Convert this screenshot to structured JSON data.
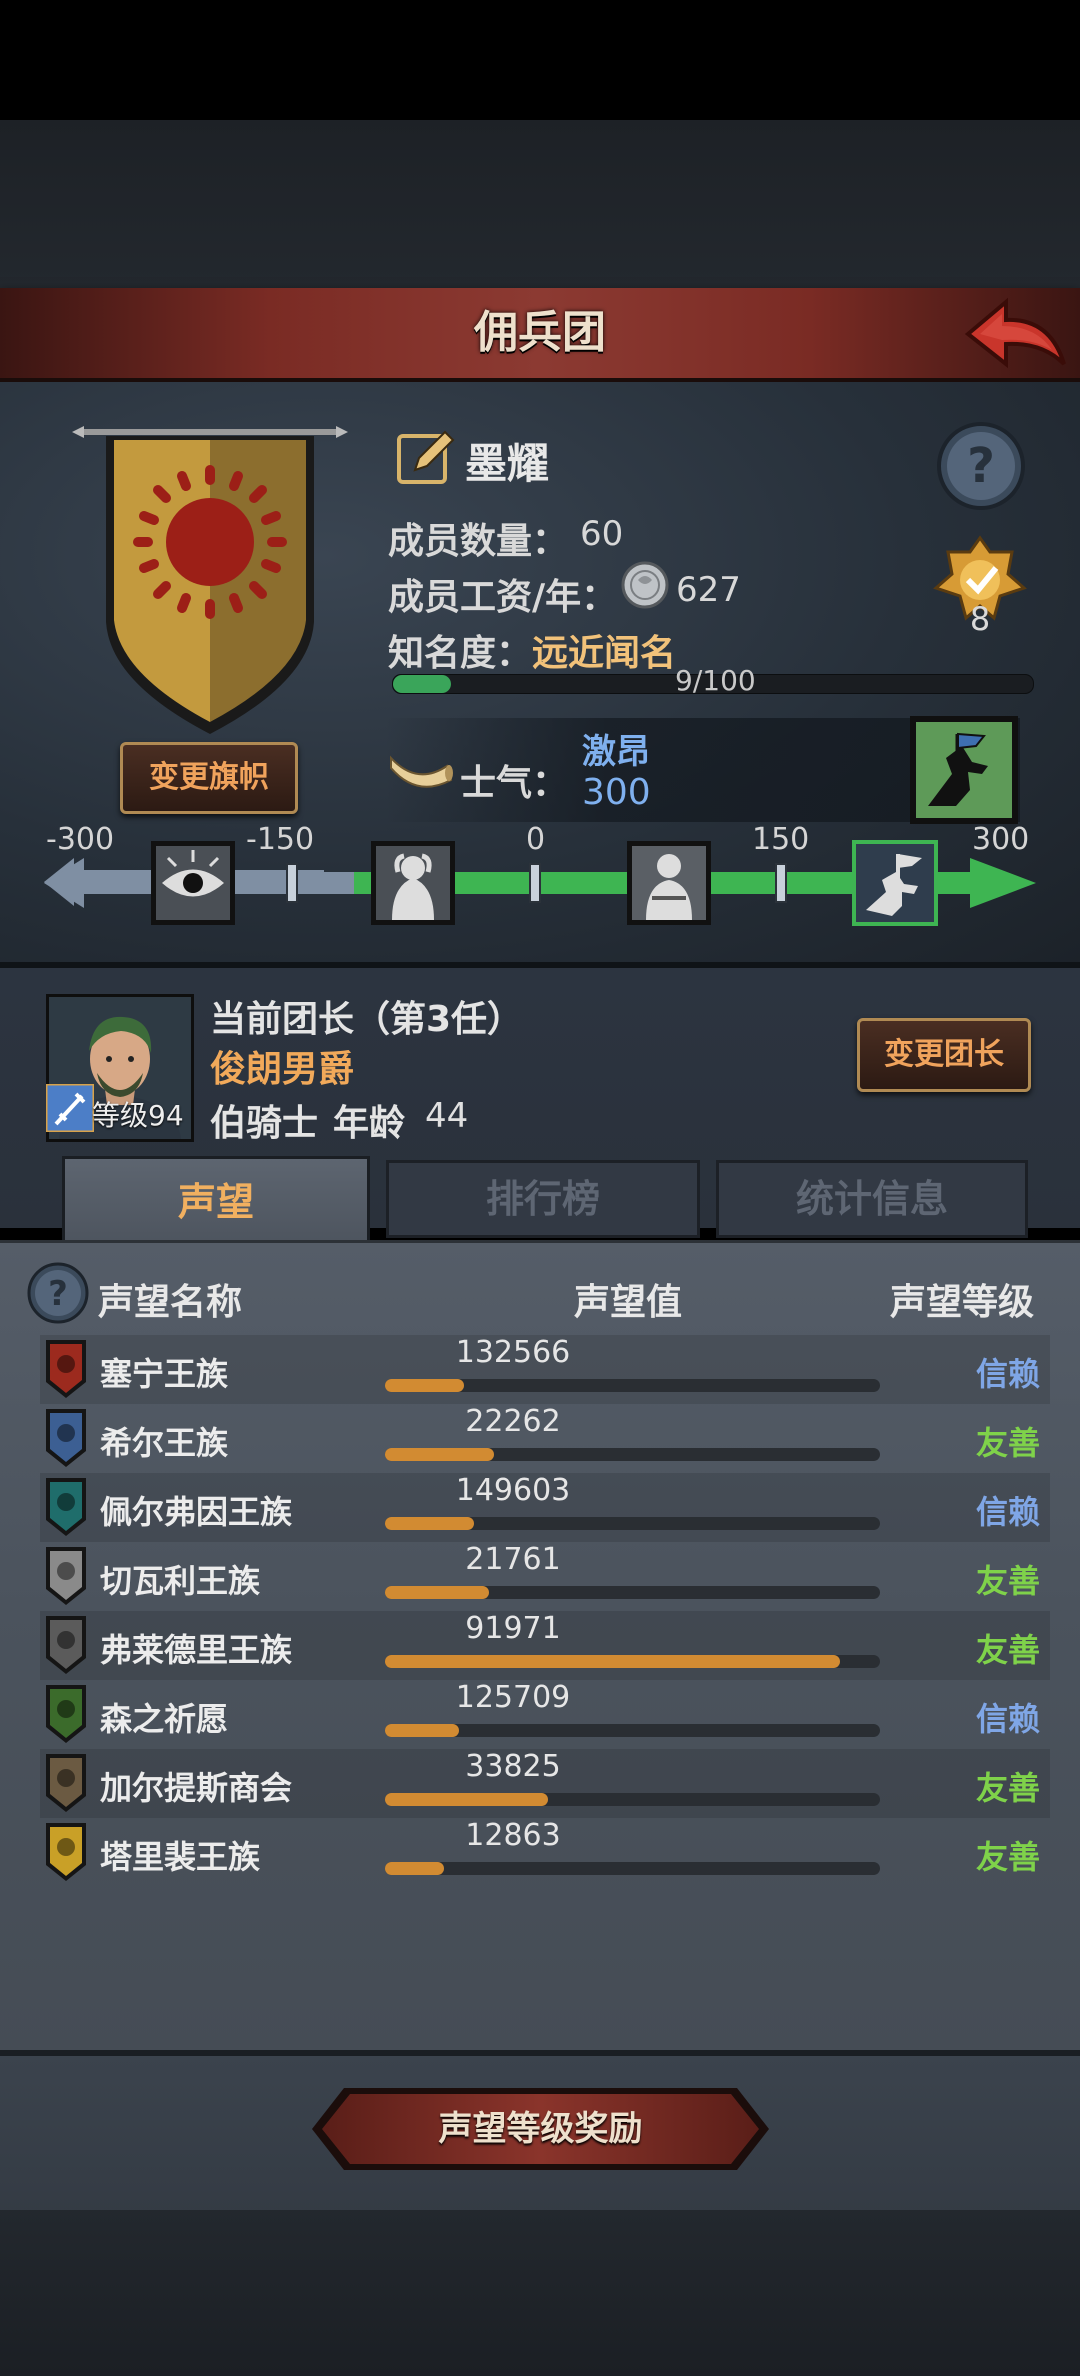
{
  "header": {
    "title": "佣兵团"
  },
  "guild": {
    "name": "墨耀",
    "change_flag_label": "变更旗帜",
    "members_label": "成员数量：",
    "members_value": "60",
    "salary_label": "成员工资/年：",
    "salary_value": "627",
    "fame_label": "知名度：",
    "fame_value": "远近闻名",
    "fame_progress": "9/100",
    "fame_fraction": 0.09,
    "rank_value": "8"
  },
  "morale": {
    "label": "士气：",
    "state": "激昂",
    "value": "300",
    "scale_labels": [
      "-300",
      "-150",
      "0",
      "150",
      "300"
    ]
  },
  "captain": {
    "title": "当前团长（第3任）",
    "name": "俊朗男爵",
    "rank": "伯骑士",
    "age_label": "年龄",
    "age": "44",
    "level": "等级94",
    "change_label": "变更团长"
  },
  "tabs": {
    "reputation": "声望",
    "ranking": "排行榜",
    "stats": "统计信息"
  },
  "reputation": {
    "headers": {
      "name": "声望名称",
      "value": "声望值",
      "level": "声望等级"
    },
    "rows": [
      {
        "name": "塞宁王族",
        "value": "132566",
        "level": "信赖",
        "fill": 0.16,
        "level_color": "#7fa6e6",
        "icon_color": "#9c2a1e"
      },
      {
        "name": "希尔王族",
        "value": "22262",
        "level": "友善",
        "fill": 0.22,
        "level_color": "#7fd24a",
        "icon_color": "#3c5f93"
      },
      {
        "name": "佩尔弗因王族",
        "value": "149603",
        "level": "信赖",
        "fill": 0.18,
        "level_color": "#7fa6e6",
        "icon_color": "#1f6d6b"
      },
      {
        "name": "切瓦利王族",
        "value": "21761",
        "level": "友善",
        "fill": 0.21,
        "level_color": "#7fd24a",
        "icon_color": "#8a8a8a"
      },
      {
        "name": "弗莱德里王族",
        "value": "91971",
        "level": "友善",
        "fill": 0.92,
        "level_color": "#7fd24a",
        "icon_color": "#5b5b5b"
      },
      {
        "name": "森之祈愿",
        "value": "125709",
        "level": "信赖",
        "fill": 0.15,
        "level_color": "#7fa6e6",
        "icon_color": "#3b6b2b"
      },
      {
        "name": "加尔提斯商会",
        "value": "33825",
        "level": "友善",
        "fill": 0.33,
        "level_color": "#7fd24a",
        "icon_color": "#6b5a42"
      },
      {
        "name": "塔里裴王族",
        "value": "12863",
        "level": "友善",
        "fill": 0.12,
        "level_color": "#7fd24a",
        "icon_color": "#c9a027"
      }
    ]
  },
  "reward_button": "声望等级奖励",
  "icons": {
    "back": "back-arrow-icon",
    "help": "question-mark-icon",
    "edit": "edit-pencil-icon",
    "coin": "silver-coin-icon",
    "rank": "rank-badge-icon",
    "horn": "war-horn-icon",
    "morale_status": "charging-soldier-icon"
  }
}
